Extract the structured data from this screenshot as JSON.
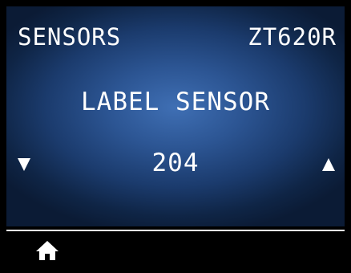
{
  "header": {
    "title": "SENSORS",
    "model": "ZT620R"
  },
  "menu": {
    "label": "LABEL SENSOR",
    "value": "204"
  },
  "icons": {
    "decrement": "triangle-down-icon",
    "increment": "triangle-up-icon",
    "home": "home-icon"
  },
  "colors": {
    "background": "#000000",
    "panel_center": "#3f6fb4",
    "panel_edge": "#0b1b35",
    "text": "#ffffff"
  }
}
